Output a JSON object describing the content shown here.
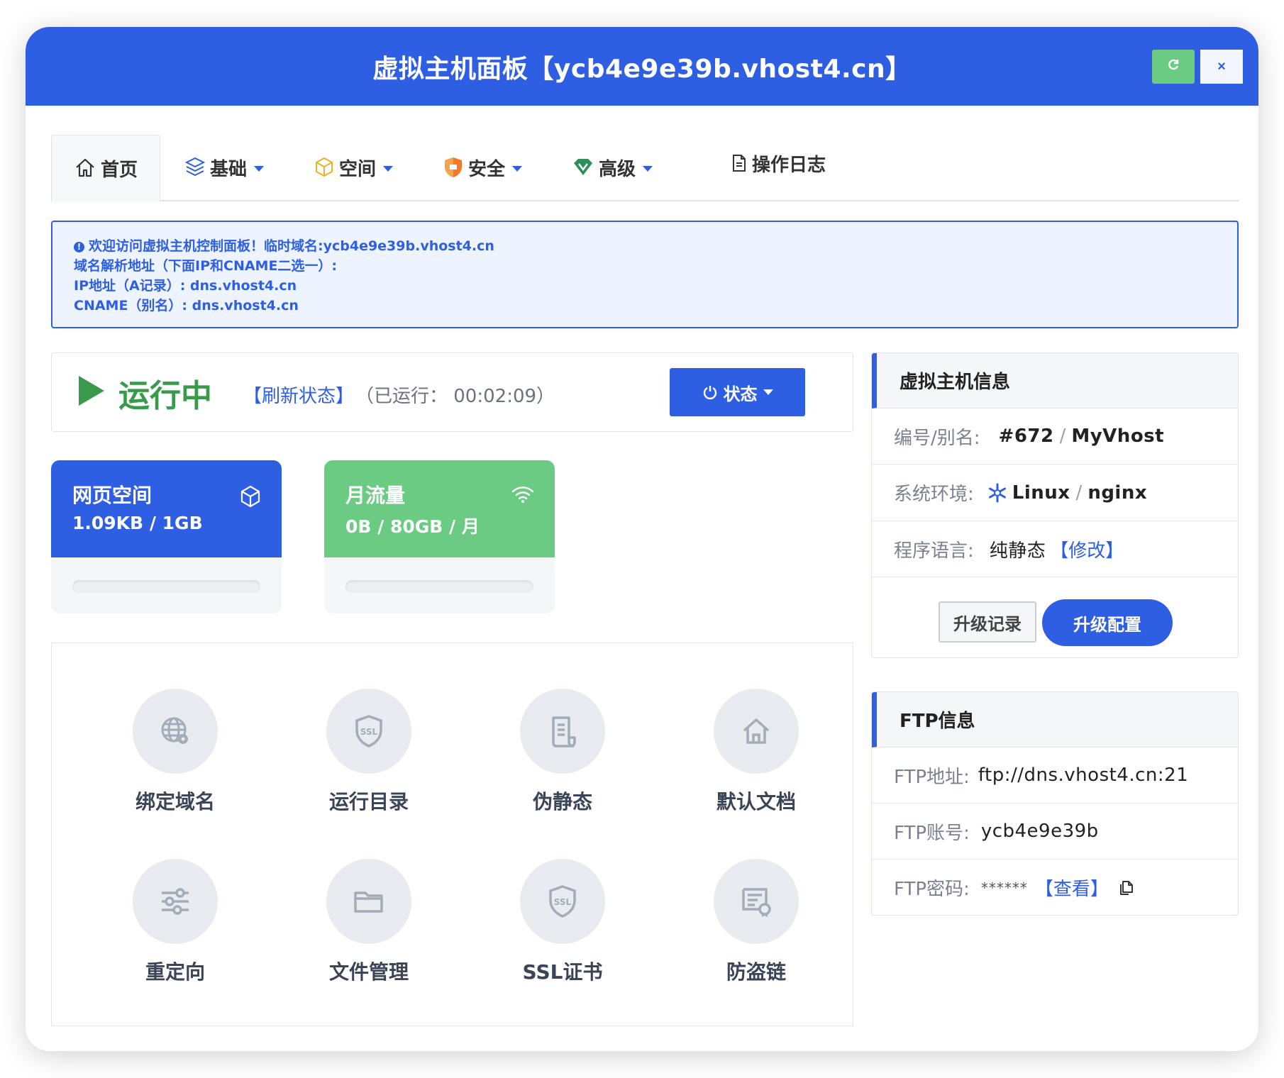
{
  "window": {
    "title": "虚拟主机面板【ycb4e9e39b.vhost4.cn】",
    "refresh_icon": "refresh-icon",
    "close_label": "×"
  },
  "tabs": [
    {
      "label": "首页",
      "icon": "home-icon",
      "active": true
    },
    {
      "label": "基础",
      "icon": "layers-icon",
      "dropdown": true
    },
    {
      "label": "空间",
      "icon": "box-icon",
      "dropdown": true
    },
    {
      "label": "安全",
      "icon": "shield-icon",
      "dropdown": true
    },
    {
      "label": "高级",
      "icon": "diamond-icon",
      "dropdown": true
    },
    {
      "label": "操作日志",
      "icon": "document-icon"
    }
  ],
  "notice": {
    "line1": "欢迎访问虚拟主机控制面板！临时域名:ycb4e9e39b.vhost4.cn",
    "line2": "域名解析地址（下面IP和CNAME二选一）:",
    "line3": "IP地址（A记录）: dns.vhost4.cn",
    "line4": "CNAME（别名）: dns.vhost4.cn"
  },
  "status": {
    "state": "运行中",
    "refresh_link": "【刷新状态】",
    "uptime": "（已运行： 00:02:09）",
    "button_label": "状态"
  },
  "usage": {
    "space": {
      "label": "网页空间",
      "value": "1.09KB / 1GB",
      "percent": 0.0001
    },
    "traffic": {
      "label": "月流量",
      "value": "0B / 80GB / 月",
      "percent": 0
    }
  },
  "features": [
    {
      "label": "绑定域名",
      "icon": "globe-gear-icon"
    },
    {
      "label": "运行目录",
      "icon": "ssl-shield-icon"
    },
    {
      "label": "伪静态",
      "icon": "scroll-icon"
    },
    {
      "label": "默认文档",
      "icon": "house-icon"
    },
    {
      "label": "重定向",
      "icon": "sliders-icon"
    },
    {
      "label": "文件管理",
      "icon": "folder-icon"
    },
    {
      "label": "SSL证书",
      "icon": "ssl-shield-icon"
    },
    {
      "label": "防盗链",
      "icon": "cert-icon"
    }
  ],
  "host_info": {
    "title": "虚拟主机信息",
    "id_label": "编号/别名:",
    "id_value": "#672",
    "alias_value": "MyVhost",
    "env_label": "系统环境:",
    "os_value": "Linux",
    "server_value": "nginx",
    "lang_label": "程序语言:",
    "lang_value": "纯静态",
    "lang_edit": "【修改】",
    "upgrade_log": "升级记录",
    "upgrade_config": "升级配置"
  },
  "ftp_info": {
    "title": "FTP信息",
    "addr_label": "FTP地址:",
    "addr_value": "ftp://dns.vhost4.cn:21",
    "account_label": "FTP账号:",
    "account_value": "ycb4e9e39b",
    "password_label": "FTP密码:",
    "password_value": "******",
    "view_link": "【查看】"
  },
  "colors": {
    "primary": "#2e5ee2",
    "success": "#3a9a4b",
    "traffic_card": "#6ccb83"
  }
}
